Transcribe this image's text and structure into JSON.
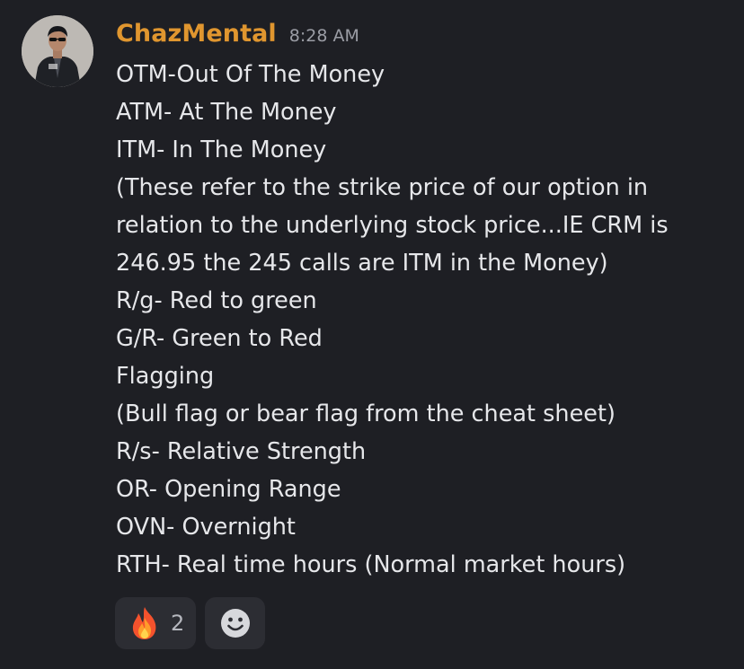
{
  "message": {
    "author": "ChazMental",
    "timestamp": "8:28 AM",
    "author_color": "#e0962f",
    "lines": [
      "OTM-Out Of The Money",
      "ATM- At The Money",
      "ITM- In The Money",
      "(These refer to the strike price of our option in",
      "relation to the underlying stock price...IE CRM is",
      "246.95 the 245 calls are ITM in the Money)",
      "R/g- Red to green",
      "G/R- Green to Red",
      "Flagging",
      "(Bull flag or bear flag from the cheat sheet)",
      "R/s- Relative Strength",
      "OR- Opening Range",
      "OVN- Overnight",
      "RTH- Real time hours (Normal market hours)"
    ]
  },
  "reactions": [
    {
      "emoji": "fire-icon",
      "count": "2"
    },
    {
      "emoji": "add-reaction-icon"
    }
  ],
  "colors": {
    "background": "#1e1f24",
    "reaction_bg": "#2c2d33",
    "text": "#e6e7ea",
    "muted": "#9b9da5"
  }
}
